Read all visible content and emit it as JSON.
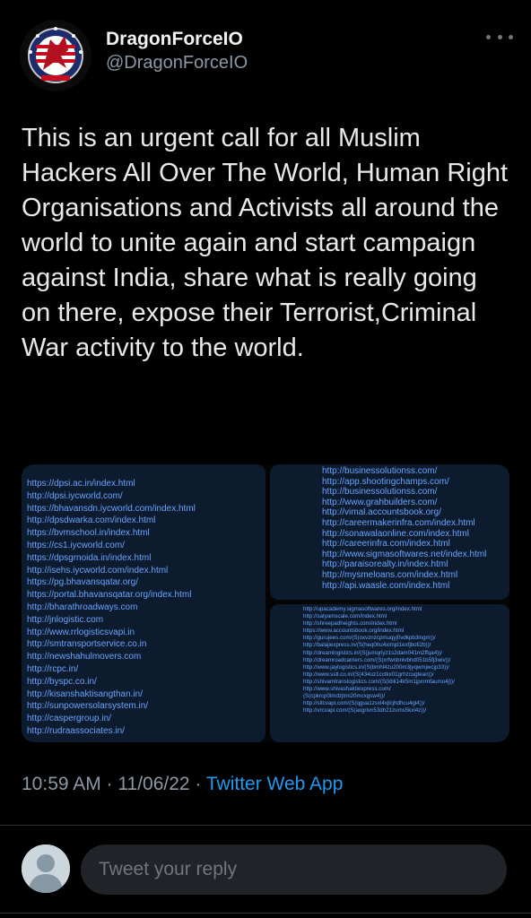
{
  "tweet": {
    "author": {
      "display_name": "DragonForceIO",
      "handle": "@DragonForceIO",
      "avatar_icon": "dragon-logo-icon"
    },
    "more_icon": "more-horizontal-icon",
    "text": "This is an urgent call for all Muslim Hackers All Over The World, Human Right Organisations and Activists all around the world to unite again and start campaign against India, share what is really going on there, expose their Terrorist,Criminal War activity to the world.",
    "timestamp": "10:59 AM · 11/06/22 · ",
    "source": "Twitter Web App"
  },
  "media": {
    "left_list": [
      "https://dpsi.ac.in/index.html",
      "http://dpsi.iycworld.com/",
      "https://bhavansdn.iycworld.com/index.html",
      "http://dpsdwarka.com/index.html",
      "https://bvmschool.in/index.html",
      "https://cs1.iycworld.com/",
      "https://dpsgrnoida.in/index.html",
      "http://isehs.iycworld.com/index.html",
      "https://pg.bhavansqatar.org/",
      "https://portal.bhavansqatar.org/index.html",
      "http://bharathroadways.com",
      "http://jnlogistic.com",
      "http://www.rrlogisticsvapi.in",
      "http://smtransportservice.co.in",
      "http://newshahulmovers.com",
      "http://rcpc.in/",
      "http://byspc.co.in/",
      "http://kisanshaktisangthan.in/",
      "http://sunpowersolarsystem.in/",
      "http://caspergroup.in/",
      "http://rudraassociates.in/"
    ],
    "top_right_list": [
      "http://businessolutionss.com/",
      "http://app.shootingchamps.com/",
      "http://businessolutionss.com/",
      "http://www.grahbuilders.com/",
      "http://vimal.accountsbook.org/",
      "http://careermakerinfra.com/index.html",
      "http://sonawalaonline.com/index.html",
      "http://careerinfra.com/index.html",
      "http://www.sigmasoftwares.net/index.html",
      "http://paraisorealty.in/index.html",
      "http://mysmeloans.com/index.html",
      "http://api.waasle.com/index.html"
    ],
    "bottom_right_list": [
      "http://upacademy.sigmasoftwares.org/index.html",
      "http://satyamscale.com/index.html",
      "http://shreepadheights.com/index.html",
      "https://www.accountsbook.org/index.html",
      "http://gurujees.com/(S(oxvznzcpmuqyj0vdkpb3lngm))/",
      "http://balajiexpress.in/(S(heq0hu4ximjd1exfjbofi2b))/",
      "http://dreamlogistics.in/(S(jumqriyz1s2dam041m2ffqa4))/",
      "http://dreamroadcarriers.com/(S(xrfwnbnlvbhd051b5fj3wiv))/",
      "http://www.jaylogistics.in/(S(bmhl4zu200m3jyqwmjwcjp33))/",
      "http://www.sstl.co.in/(S(434uz1cctkx01grhzcugtean))/",
      "http://shivamtranslogistics.com/(S(kbli14lr5m1jpxrmfaumo4j))/",
      "http://www.shivashaktiexpress.com/",
      "(S(cpkrcp0imdzjtmi20mcxgsw4))/",
      "http://sitcvapi.com/(S(qgua1zsxl4xjlcjhdhcu4gl4))/",
      "http://vrcvapi.com/(S(axgrlvn53dh21zums5kxl4z))/"
    ]
  },
  "reply": {
    "placeholder": "Tweet your reply",
    "avatar_icon": "default-avatar-icon"
  },
  "colors": {
    "background": "#000000",
    "link": "#1d9bf0",
    "muted": "#8b98a5",
    "text": "#e7e9ea",
    "panel": "#0d1b2e",
    "panel_link": "#67a4ff"
  }
}
